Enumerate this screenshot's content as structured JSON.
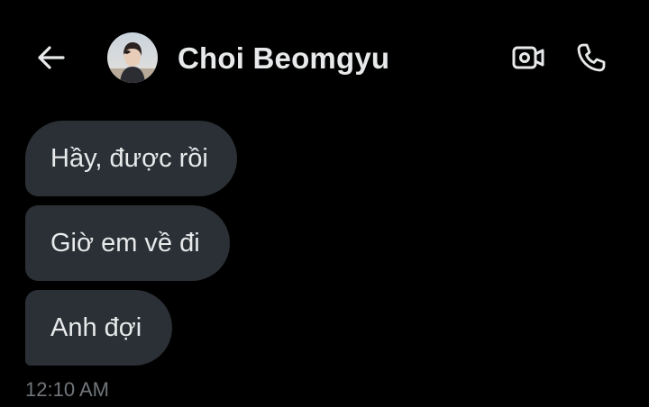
{
  "header": {
    "back_icon": "arrow-left-icon",
    "contact_name": "Choi Beomgyu",
    "video_icon": "video-camera-icon",
    "call_icon": "phone-icon"
  },
  "messages": [
    {
      "text": "Hầy, được rồi"
    },
    {
      "text": "Giờ em về đi"
    },
    {
      "text": "Anh đợi"
    }
  ],
  "timestamp": "12:10 AM",
  "colors": {
    "background": "#000000",
    "bubble": "#2a3035",
    "text": "#e7e9ea",
    "muted": "#71767b"
  }
}
